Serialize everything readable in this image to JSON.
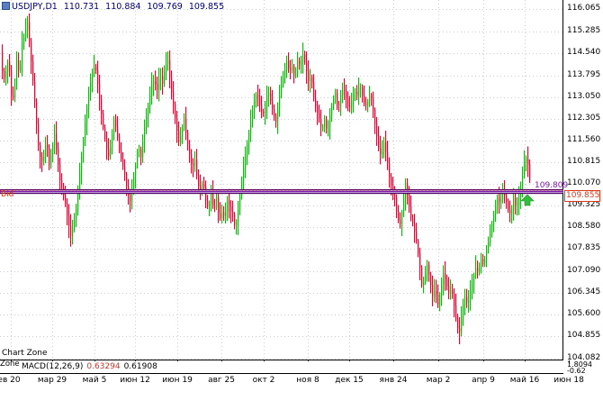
{
  "header": {
    "symbol": "USDJPY,D1",
    "open": "110.731",
    "high": "110.884",
    "low": "109.769",
    "close": "109.855"
  },
  "price_axis": [
    "116.065",
    "115.285",
    "114.540",
    "113.795",
    "113.050",
    "112.305",
    "111.560",
    "110.815",
    "110.070",
    "109.325",
    "108.580",
    "107.835",
    "107.090",
    "106.345",
    "105.600",
    "104.855",
    "104.082"
  ],
  "time_axis": [
    "ев 20",
    "мар 29",
    "май 5",
    "июн 12",
    "июн 19",
    "авг 25",
    "окт 2",
    "ноя 8",
    "дек 15",
    "янв 24",
    "мар 2",
    "апр 9",
    "май 16",
    "июн 18"
  ],
  "bid": {
    "label": "Bid",
    "price": "109.855",
    "color": "#d93a1a"
  },
  "level": {
    "value": "109.809",
    "color": "#7a1aa8"
  },
  "chart_zone_label": "Chart Zone",
  "zone_label": "Zone",
  "macd": {
    "name": "MACD(12,26,9)",
    "value1": "0.63294",
    "value2": "0.61908",
    "axis_top": "1.8094",
    "axis_bottom": "-0.62"
  },
  "colors": {
    "bull": "#2aa52a",
    "bear": "#c8102e",
    "grid": "#c9cdd6",
    "arrow": "#2fbf3a"
  },
  "chart_data": {
    "type": "candlestick",
    "symbol": "USDJPY",
    "timeframe": "D1",
    "ylim": [
      104.082,
      116.065
    ],
    "path": [
      [
        0,
        114.6
      ],
      [
        3,
        113.6
      ],
      [
        6,
        113.9
      ],
      [
        9,
        114.4
      ],
      [
        12,
        113.1
      ],
      [
        15,
        113.0
      ],
      [
        18,
        114.3
      ],
      [
        21,
        113.8
      ],
      [
        24,
        114.9
      ],
      [
        27,
        115.2
      ],
      [
        30,
        115.6
      ],
      [
        33,
        114.6
      ],
      [
        36,
        113.6
      ],
      [
        39,
        112.5
      ],
      [
        42,
        111.4
      ],
      [
        45,
        110.8
      ],
      [
        48,
        111.0
      ],
      [
        51,
        111.6
      ],
      [
        54,
        110.7
      ],
      [
        57,
        111.2
      ],
      [
        60,
        111.8
      ],
      [
        63,
        111.0
      ],
      [
        66,
        110.2
      ],
      [
        69,
        109.8
      ],
      [
        72,
        109.4
      ],
      [
        75,
        108.8
      ],
      [
        78,
        108.3
      ],
      [
        81,
        108.6
      ],
      [
        84,
        109.2
      ],
      [
        87,
        110.2
      ],
      [
        90,
        111.0
      ],
      [
        93,
        111.9
      ],
      [
        96,
        112.7
      ],
      [
        99,
        113.4
      ],
      [
        102,
        113.9
      ],
      [
        105,
        114.2
      ],
      [
        108,
        113.5
      ],
      [
        111,
        112.7
      ],
      [
        114,
        112.0
      ],
      [
        117,
        111.4
      ],
      [
        120,
        111.0
      ],
      [
        123,
        111.5
      ],
      [
        126,
        112.3
      ],
      [
        129,
        111.9
      ],
      [
        132,
        111.2
      ],
      [
        135,
        110.8
      ],
      [
        138,
        110.4
      ],
      [
        141,
        109.8
      ],
      [
        144,
        109.5
      ],
      [
        147,
        110.1
      ],
      [
        150,
        110.7
      ],
      [
        153,
        111.4
      ],
      [
        156,
        111.0
      ],
      [
        159,
        111.8
      ],
      [
        162,
        112.4
      ],
      [
        165,
        112.9
      ],
      [
        168,
        113.5
      ],
      [
        171,
        113.6
      ],
      [
        174,
        113.3
      ],
      [
        177,
        113.9
      ],
      [
        180,
        113.5
      ],
      [
        183,
        114.1
      ],
      [
        186,
        114.3
      ],
      [
        189,
        113.4
      ],
      [
        192,
        112.8
      ],
      [
        195,
        112.1
      ],
      [
        198,
        111.5
      ],
      [
        201,
        111.8
      ],
      [
        204,
        112.3
      ],
      [
        207,
        111.6
      ],
      [
        210,
        111.1
      ],
      [
        213,
        110.6
      ],
      [
        216,
        110.9
      ],
      [
        219,
        110.1
      ],
      [
        222,
        109.8
      ],
      [
        225,
        110.2
      ],
      [
        228,
        109.5
      ],
      [
        231,
        109.2
      ],
      [
        234,
        109.8
      ],
      [
        237,
        109.1
      ],
      [
        240,
        109.6
      ],
      [
        243,
        108.8
      ],
      [
        246,
        109.1
      ],
      [
        249,
        108.9
      ],
      [
        252,
        109.5
      ],
      [
        255,
        109.2
      ],
      [
        258,
        109.0
      ],
      [
        261,
        108.5
      ],
      [
        264,
        109.2
      ],
      [
        267,
        109.9
      ],
      [
        270,
        110.6
      ],
      [
        273,
        111.2
      ],
      [
        276,
        111.8
      ],
      [
        279,
        112.4
      ],
      [
        282,
        112.9
      ],
      [
        285,
        113.2
      ],
      [
        288,
        112.8
      ],
      [
        291,
        112.4
      ],
      [
        294,
        112.7
      ],
      [
        297,
        113.3
      ],
      [
        300,
        112.9
      ],
      [
        303,
        112.5
      ],
      [
        306,
        112.2
      ],
      [
        309,
        112.9
      ],
      [
        312,
        113.5
      ],
      [
        315,
        113.8
      ],
      [
        318,
        114.3
      ],
      [
        321,
        113.9
      ],
      [
        324,
        114.1
      ],
      [
        327,
        113.6
      ],
      [
        330,
        114.3
      ],
      [
        333,
        114.1
      ],
      [
        336,
        114.5
      ],
      [
        339,
        114.1
      ],
      [
        342,
        113.6
      ],
      [
        345,
        113.8
      ],
      [
        348,
        113.0
      ],
      [
        351,
        112.6
      ],
      [
        354,
        112.3
      ],
      [
        357,
        111.9
      ],
      [
        360,
        112.3
      ],
      [
        363,
        111.8
      ],
      [
        366,
        112.4
      ],
      [
        369,
        112.9
      ],
      [
        372,
        113.2
      ],
      [
        375,
        112.6
      ],
      [
        378,
        113.1
      ],
      [
        381,
        113.4
      ],
      [
        384,
        113.0
      ],
      [
        387,
        112.6
      ],
      [
        390,
        112.9
      ],
      [
        393,
        113.3
      ],
      [
        396,
        113.1
      ],
      [
        399,
        113.5
      ],
      [
        402,
        113.1
      ],
      [
        405,
        112.7
      ],
      [
        408,
        112.9
      ],
      [
        411,
        113.2
      ],
      [
        414,
        112.6
      ],
      [
        417,
        111.9
      ],
      [
        420,
        111.3
      ],
      [
        423,
        111.0
      ],
      [
        426,
        111.5
      ],
      [
        429,
        111.0
      ],
      [
        432,
        110.3
      ],
      [
        435,
        109.9
      ],
      [
        438,
        109.6
      ],
      [
        441,
        108.9
      ],
      [
        444,
        108.7
      ],
      [
        447,
        109.3
      ],
      [
        450,
        110.1
      ],
      [
        453,
        109.5
      ],
      [
        456,
        108.9
      ],
      [
        459,
        108.6
      ],
      [
        462,
        108.1
      ],
      [
        465,
        107.5
      ],
      [
        468,
        106.6
      ],
      [
        471,
        106.8
      ],
      [
        474,
        107.3
      ],
      [
        477,
        106.8
      ],
      [
        480,
        106.2
      ],
      [
        483,
        106.5
      ],
      [
        486,
        105.9
      ],
      [
        489,
        106.4
      ],
      [
        492,
        107.0
      ],
      [
        495,
        106.7
      ],
      [
        498,
        106.3
      ],
      [
        501,
        106.5
      ],
      [
        504,
        105.9
      ],
      [
        507,
        105.2
      ],
      [
        510,
        105.0
      ],
      [
        513,
        105.8
      ],
      [
        516,
        106.2
      ],
      [
        519,
        105.9
      ],
      [
        522,
        106.4
      ],
      [
        525,
        106.8
      ],
      [
        528,
        107.2
      ],
      [
        531,
        107.0
      ],
      [
        534,
        107.5
      ],
      [
        537,
        107.3
      ],
      [
        540,
        107.8
      ],
      [
        543,
        108.2
      ],
      [
        546,
        108.7
      ],
      [
        549,
        109.2
      ],
      [
        552,
        109.6
      ],
      [
        555,
        109.4
      ],
      [
        558,
        109.8
      ],
      [
        561,
        109.6
      ],
      [
        564,
        109.2
      ],
      [
        567,
        109.0
      ],
      [
        570,
        109.6
      ],
      [
        573,
        109.2
      ],
      [
        576,
        109.6
      ],
      [
        579,
        110.1
      ],
      [
        582,
        110.8
      ],
      [
        585,
        111.0
      ],
      [
        588,
        110.2
      ],
      [
        590,
        109.855
      ]
    ],
    "bid_price": 109.855,
    "horizontal_level": 109.809
  }
}
